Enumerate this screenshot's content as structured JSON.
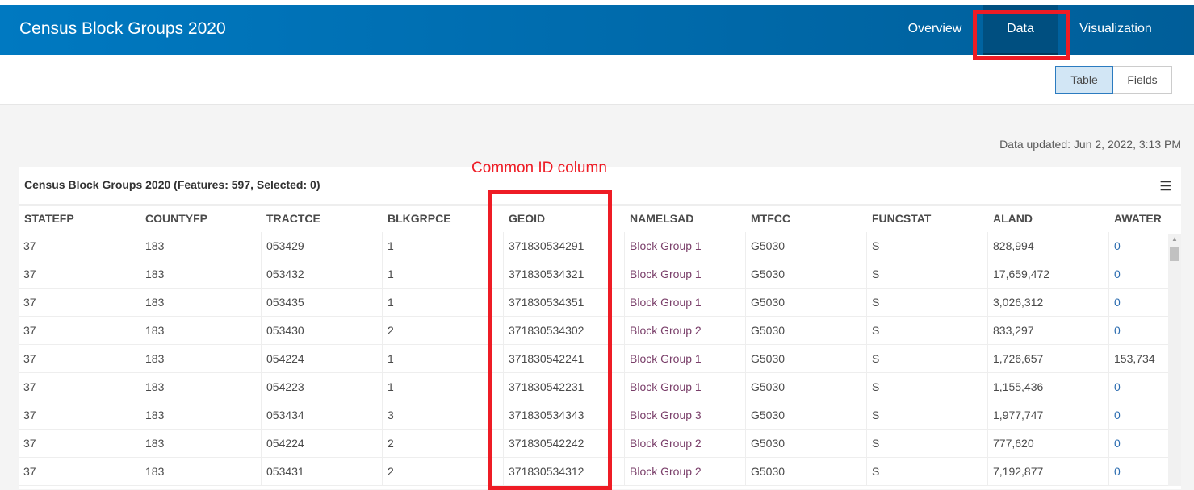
{
  "header": {
    "title": "Census Block Groups 2020",
    "tabs": [
      "Overview",
      "Data",
      "Visualization"
    ],
    "active_tab": "Data",
    "color": "#0079c1"
  },
  "view_toggle": {
    "table": "Table",
    "fields": "Fields",
    "active": "Table"
  },
  "updated": "Data updated: Jun 2, 2022, 3:13 PM",
  "table": {
    "title": "Census Block Groups 2020 (Features: 597, Selected: 0)",
    "columns": [
      "STATEFP",
      "COUNTYFP",
      "TRACTCE",
      "BLKGRPCE",
      "GEOID",
      "NAMELSAD",
      "MTFCC",
      "FUNCSTAT",
      "ALAND",
      "AWATER"
    ],
    "rows": [
      [
        "37",
        "183",
        "053429",
        "1",
        "371830534291",
        "Block Group 1",
        "G5030",
        "S",
        "828,994",
        "0"
      ],
      [
        "37",
        "183",
        "053432",
        "1",
        "371830534321",
        "Block Group 1",
        "G5030",
        "S",
        "17,659,472",
        "0"
      ],
      [
        "37",
        "183",
        "053435",
        "1",
        "371830534351",
        "Block Group 1",
        "G5030",
        "S",
        "3,026,312",
        "0"
      ],
      [
        "37",
        "183",
        "053430",
        "2",
        "371830534302",
        "Block Group 2",
        "G5030",
        "S",
        "833,297",
        "0"
      ],
      [
        "37",
        "183",
        "054224",
        "1",
        "371830542241",
        "Block Group 1",
        "G5030",
        "S",
        "1,726,657",
        "153,734"
      ],
      [
        "37",
        "183",
        "054223",
        "1",
        "371830542231",
        "Block Group 1",
        "G5030",
        "S",
        "1,155,436",
        "0"
      ],
      [
        "37",
        "183",
        "053434",
        "3",
        "371830534343",
        "Block Group 3",
        "G5030",
        "S",
        "1,977,747",
        "0"
      ],
      [
        "37",
        "183",
        "054224",
        "2",
        "371830542242",
        "Block Group 2",
        "G5030",
        "S",
        "777,620",
        "0"
      ],
      [
        "37",
        "183",
        "053431",
        "2",
        "371830534312",
        "Block Group 2",
        "G5030",
        "S",
        "7,192,877",
        "0"
      ]
    ]
  },
  "annotation": {
    "text": "Common ID column",
    "color": "#ee1c25"
  }
}
